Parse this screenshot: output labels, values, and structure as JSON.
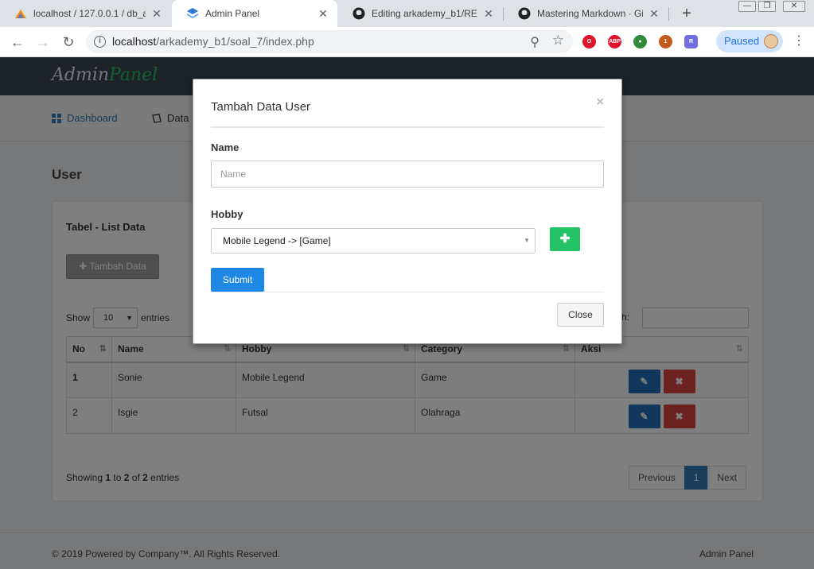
{
  "browser": {
    "tabs": [
      {
        "title": "localhost / 127.0.0.1 / db_arkademy",
        "favicon": "phpmyadmin-icon",
        "active": false
      },
      {
        "title": "Admin Panel",
        "favicon": "layers-icon",
        "active": true
      },
      {
        "title": "Editing arkademy_b1/README.md",
        "favicon": "github-icon",
        "active": false
      },
      {
        "title": "Mastering Markdown · GitHub Guides",
        "favicon": "github-icon",
        "active": false
      }
    ],
    "url_host": "localhost",
    "url_path": "/arkademy_b1/soal_7/index.php",
    "profile_status": "Paused",
    "extensions": [
      {
        "name": "opera-ext-icon",
        "label": "",
        "color": "#e0142b"
      },
      {
        "name": "adblock-ext-icon",
        "label": "ABP",
        "color": "#e0142b"
      },
      {
        "name": "globe-ext-icon",
        "label": "",
        "color": "#2f8a3b"
      },
      {
        "name": "monkey-ext-icon",
        "label": "1",
        "color": "#c45a1e"
      },
      {
        "name": "r-ext-icon",
        "label": "R",
        "color": "#6f6fe0"
      }
    ]
  },
  "app": {
    "brand_first": "Admin",
    "brand_second": "Panel",
    "menu": {
      "dashboard": "Dashboard",
      "data": "Data"
    },
    "page_title": "User",
    "card_title": "Tabel - List Data",
    "add_button": "Tambah Data",
    "show_label": "Show",
    "entries_count": "10",
    "entries_label": "entries",
    "search_label": "rch:",
    "columns": [
      "No",
      "Name",
      "Hobby",
      "Category",
      "Aksi"
    ],
    "rows": [
      {
        "no": "1",
        "name": "Sonie",
        "hobby": "Mobile Legend",
        "category": "Game"
      },
      {
        "no": "2",
        "name": "Isgie",
        "hobby": "Futsal",
        "category": "Olahraga"
      }
    ],
    "info_prefix": "Showing ",
    "info_from": "1",
    "info_to_word": " to ",
    "info_to": "2",
    "info_of_word": " of ",
    "info_total": "2",
    "info_suffix": " entries",
    "pager": {
      "previous": "Previous",
      "current": "1",
      "next": "Next"
    },
    "footer_left": "© 2019 Powered by Company™. All Rights Reserved.",
    "footer_right": "Admin Panel",
    "colors": {
      "topbar": "#3a4651",
      "brand_green": "#24c065",
      "primary": "#337ab7",
      "danger": "#d64541",
      "edit": "#2270b8"
    }
  },
  "modal": {
    "title": "Tambah Data User",
    "name_label": "Name",
    "name_placeholder": "Name",
    "hobby_label": "Hobby",
    "hobby_selected": "Mobile Legend -> [Game]",
    "submit_label": "Submit",
    "close_label": "Close",
    "colors": {
      "add_green": "#23c264",
      "submit_blue": "#1f88e5"
    }
  }
}
